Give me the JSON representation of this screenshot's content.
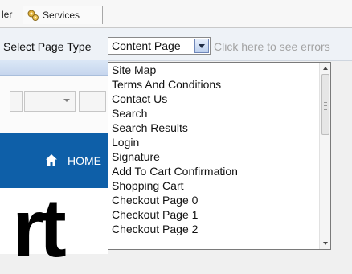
{
  "tabs": [
    {
      "label": "ler"
    },
    {
      "label": "Services",
      "icon": "gear-group-icon"
    }
  ],
  "toolbar": {
    "page_type_label": "Select Page Type",
    "select_value": "Content Page",
    "errors_link": "Click here to see errors"
  },
  "page": {
    "nav_home": "HOME",
    "logo_text": "rt"
  },
  "dropdown": {
    "options": [
      "Site Map",
      "Terms And Conditions",
      "Contact Us",
      "Search",
      "Search Results",
      "Login",
      "Signature",
      "Add To Cart Confirmation",
      "Shopping Cart",
      "Checkout Page 0",
      "Checkout Page 1",
      "Checkout Page 2"
    ]
  },
  "colors": {
    "nav_blue": "#0e5fa8",
    "select_arrow": "#6f86b8",
    "errors_link": "#a3a3a3"
  }
}
